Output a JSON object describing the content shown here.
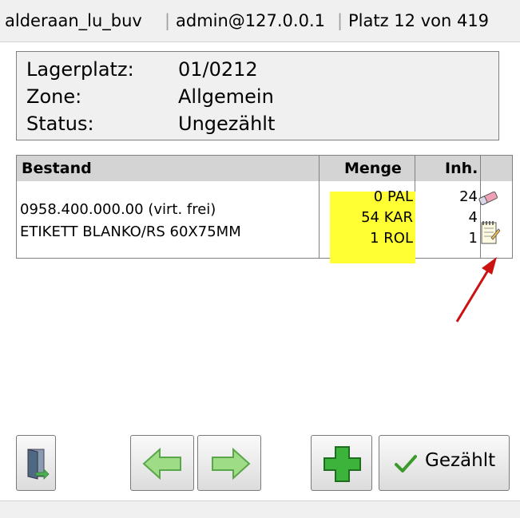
{
  "titlebar": {
    "user": "alderaan_lu_buv",
    "server": "admin@127.0.0.1",
    "position": "Platz 12 von 419"
  },
  "info": {
    "lagerplatz_label": "Lagerplatz:",
    "lagerplatz_value": "01/0212",
    "zone_label": "Zone:",
    "zone_value": "Allgemein",
    "status_label": "Status:",
    "status_value": "Ungezählt"
  },
  "stock": {
    "headers": {
      "bestand": "Bestand",
      "menge": "Menge",
      "inhalt": "Inh."
    },
    "item": {
      "number": "0958.400.000.00 (virt. frei)",
      "name": "ETIKETT BLANKO/RS 60X75MM"
    },
    "quantities": [
      {
        "qty": "0 PAL",
        "content": "24"
      },
      {
        "qty": "54 KAR",
        "content": "4"
      },
      {
        "qty": "1 ROL",
        "content": "1"
      }
    ],
    "highlight_color": "#ffff33"
  },
  "buttons": {
    "confirm_label": "Gezählt"
  },
  "icons": {
    "exit": "exit-door-icon",
    "back": "arrow-left-icon",
    "forward": "arrow-right-icon",
    "add": "plus-icon",
    "check": "checkmark-icon",
    "eraser": "eraser-icon",
    "notes": "notepad-icon"
  },
  "colors": {
    "arrow_annotation": "#cc1111",
    "green_icon": "#5cc85c"
  }
}
